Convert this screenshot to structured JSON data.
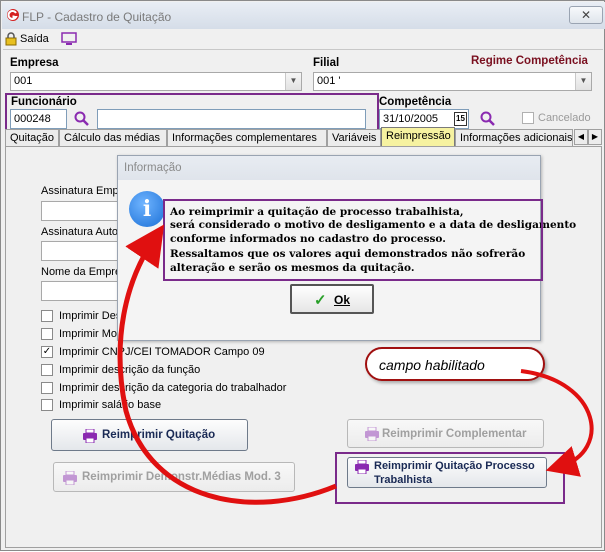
{
  "window": {
    "title": "FLP - Cadastro de Quitação",
    "close_glyph": "✕"
  },
  "toolbar": {
    "exit_label": "Saída"
  },
  "header": {
    "empresa_label": "Empresa",
    "empresa_value": "001",
    "filial_label": "Filial",
    "filial_value": "001 '",
    "regime_label": "Regime Competência",
    "funcionario_label": "Funcionário",
    "funcionario_code": "000248",
    "funcionario_name": "",
    "competencia_label": "Competência",
    "competencia_value": "31/10/2005",
    "calendar_badge": "15",
    "cancelado_label": "Cancelado"
  },
  "tabs": [
    {
      "label": "Quitação"
    },
    {
      "label": "Cálculo das médias"
    },
    {
      "label": "Informações complementares"
    },
    {
      "label": "Variáveis"
    },
    {
      "label": "Reimpressão"
    },
    {
      "label": "Informações adicionais"
    }
  ],
  "panel": {
    "assinatura_emp_label": "Assinatura Emp",
    "assinatura_auto_label": "Assinatura Auto",
    "nome_empresa_label": "Nome da Empre",
    "checkboxes": [
      {
        "label": "Imprimir Des",
        "checked": false
      },
      {
        "label": "Imprimir Moc",
        "checked": false
      },
      {
        "label": "Imprimir CNPJ/CEI TOMADOR Campo 09",
        "checked": true
      },
      {
        "label": "Imprimir descrição da função",
        "checked": false
      },
      {
        "label": "Imprimir descrição da categoria do trabalhador",
        "checked": false
      },
      {
        "label": "Imprimir salário base",
        "checked": false
      }
    ],
    "buttons": {
      "reimprimir_quitacao": "Reimprimir Quitação",
      "reimprimir_complementar": "Reimprimir Complementar",
      "reimprimir_demonstr": "Reimprimir Demonstr.Médias Mod. 3",
      "reimprimir_processo_line1": "Reimprimir Quitação Processo",
      "reimprimir_processo_line2": "Trabalhista"
    }
  },
  "dialog": {
    "title": "Informação",
    "info_glyph": "i",
    "message_lines": [
      "Ao reimprimir a quitação de processo trabalhista,",
      "será considerado o motivo de desligamento e a data de desligamento",
      "conforme informados no cadastro do processo.",
      "Ressaltamos que os valores aqui demonstrados não sofrerão",
      "alteração e serão os mesmos da quitação."
    ],
    "ok_label": "Ok"
  },
  "annotation": {
    "callout_text": "campo habilitado"
  },
  "colors": {
    "highlight": "#7a2a8a",
    "arrow": "#e01010",
    "regime": "#7a1020",
    "tab_active": "#f6f2a0"
  }
}
